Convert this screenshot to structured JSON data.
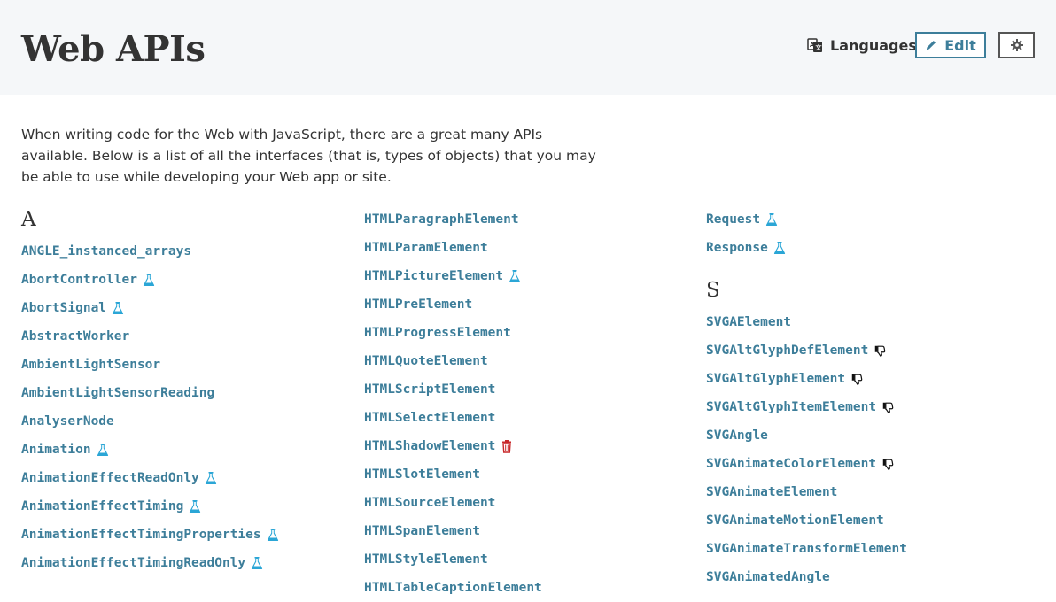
{
  "header": {
    "title": "Web APIs",
    "languages_label": "Languages",
    "edit_label": "Edit"
  },
  "intro": "When writing code for the Web with JavaScript, there are a great many APIs available. Below is a list of all the interfaces (that is, types of objects) that you may be able to use while developing your Web app or site.",
  "columns": {
    "col1": {
      "letter": "A",
      "items": [
        {
          "name": "ANGLE_instanced_arrays",
          "icon": ""
        },
        {
          "name": "AbortController",
          "icon": "experimental-flask-icon"
        },
        {
          "name": "AbortSignal",
          "icon": "experimental-flask-icon"
        },
        {
          "name": "AbstractWorker",
          "icon": ""
        },
        {
          "name": "AmbientLightSensor",
          "icon": ""
        },
        {
          "name": "AmbientLightSensorReading",
          "icon": ""
        },
        {
          "name": "AnalyserNode",
          "icon": ""
        },
        {
          "name": "Animation",
          "icon": "experimental-flask-icon"
        },
        {
          "name": "AnimationEffectReadOnly",
          "icon": "experimental-flask-icon"
        },
        {
          "name": "AnimationEffectTiming",
          "icon": "experimental-flask-icon"
        },
        {
          "name": "AnimationEffectTimingProperties",
          "icon": "experimental-flask-icon"
        },
        {
          "name": "AnimationEffectTimingReadOnly",
          "icon": "experimental-flask-icon"
        }
      ]
    },
    "col2": {
      "items": [
        {
          "name": "HTMLParagraphElement",
          "icon": ""
        },
        {
          "name": "HTMLParamElement",
          "icon": ""
        },
        {
          "name": "HTMLPictureElement",
          "icon": "experimental-flask-icon"
        },
        {
          "name": "HTMLPreElement",
          "icon": ""
        },
        {
          "name": "HTMLProgressElement",
          "icon": ""
        },
        {
          "name": "HTMLQuoteElement",
          "icon": ""
        },
        {
          "name": "HTMLScriptElement",
          "icon": ""
        },
        {
          "name": "HTMLSelectElement",
          "icon": ""
        },
        {
          "name": "HTMLShadowElement",
          "icon": "obsolete-trash-icon"
        },
        {
          "name": "HTMLSlotElement",
          "icon": ""
        },
        {
          "name": "HTMLSourceElement",
          "icon": ""
        },
        {
          "name": "HTMLSpanElement",
          "icon": ""
        },
        {
          "name": "HTMLStyleElement",
          "icon": ""
        },
        {
          "name": "HTMLTableCaptionElement",
          "icon": ""
        }
      ]
    },
    "col3": {
      "items_top": [
        {
          "name": "Request",
          "icon": "experimental-flask-icon"
        },
        {
          "name": "Response",
          "icon": "experimental-flask-icon"
        }
      ],
      "letter": "S",
      "items": [
        {
          "name": "SVGAElement",
          "icon": ""
        },
        {
          "name": "SVGAltGlyphDefElement",
          "icon": "deprecated-thumbs-down-icon"
        },
        {
          "name": "SVGAltGlyphElement",
          "icon": "deprecated-thumbs-down-icon"
        },
        {
          "name": "SVGAltGlyphItemElement",
          "icon": "deprecated-thumbs-down-icon"
        },
        {
          "name": "SVGAngle",
          "icon": ""
        },
        {
          "name": "SVGAnimateColorElement",
          "icon": "deprecated-thumbs-down-icon"
        },
        {
          "name": "SVGAnimateElement",
          "icon": ""
        },
        {
          "name": "SVGAnimateMotionElement",
          "icon": ""
        },
        {
          "name": "SVGAnimateTransformElement",
          "icon": ""
        },
        {
          "name": "SVGAnimatedAngle",
          "icon": ""
        }
      ]
    }
  },
  "colors": {
    "link": "#3d7e9a",
    "flask": "#2ba6d6",
    "trash": "#c8282a",
    "header_bg": "#f5f7f9"
  }
}
